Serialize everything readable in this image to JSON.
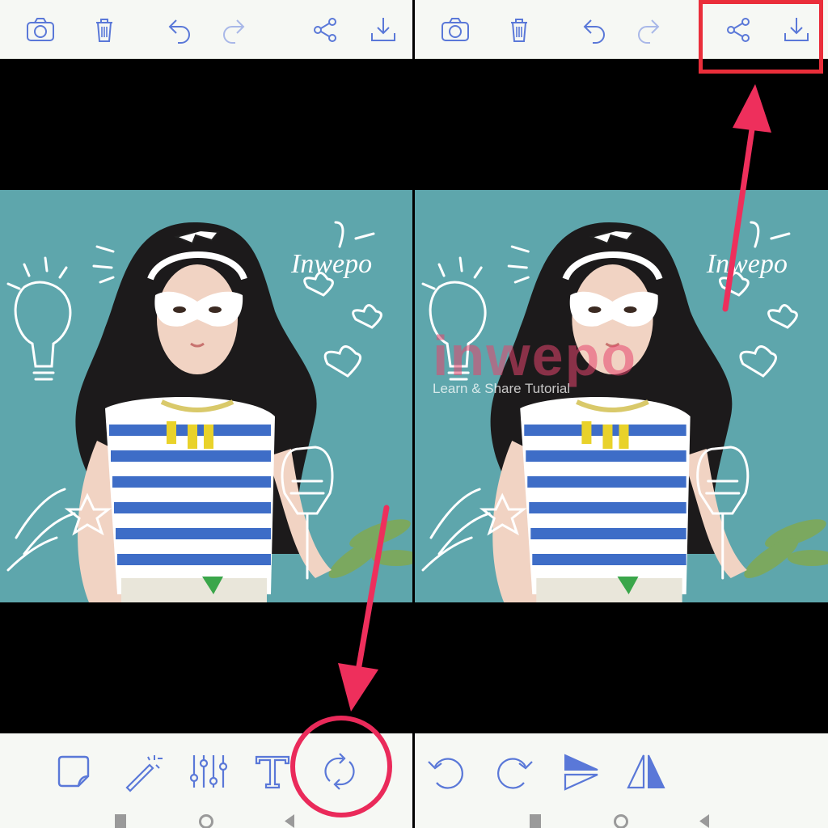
{
  "panels": [
    {
      "id": "left",
      "top_toolbar": [
        {
          "icon": "camera-icon",
          "label": "Camera"
        },
        {
          "icon": "trash-icon",
          "label": "Delete"
        },
        {
          "icon": "undo-icon",
          "label": "Undo"
        },
        {
          "icon": "redo-icon",
          "label": "Redo"
        },
        {
          "icon": "share-icon",
          "label": "Share"
        },
        {
          "icon": "download-icon",
          "label": "Save"
        }
      ],
      "photo_text": "Inwepo",
      "bottom_toolbar": [
        {
          "icon": "sticker-icon",
          "label": "Sticker"
        },
        {
          "icon": "magic-wand-icon",
          "label": "Effects"
        },
        {
          "icon": "sliders-icon",
          "label": "Adjust"
        },
        {
          "icon": "text-icon",
          "label": "Text"
        },
        {
          "icon": "rotate-icon",
          "label": "Rotate"
        }
      ]
    },
    {
      "id": "right",
      "top_toolbar": [
        {
          "icon": "camera-icon",
          "label": "Camera"
        },
        {
          "icon": "trash-icon",
          "label": "Delete"
        },
        {
          "icon": "undo-icon",
          "label": "Undo"
        },
        {
          "icon": "redo-icon",
          "label": "Redo"
        },
        {
          "icon": "share-icon",
          "label": "Share"
        },
        {
          "icon": "download-icon",
          "label": "Save"
        }
      ],
      "photo_text": "Inwepo",
      "bottom_toolbar": [
        {
          "icon": "rotate-left-icon",
          "label": "Rotate left"
        },
        {
          "icon": "rotate-right-icon",
          "label": "Rotate right"
        },
        {
          "icon": "flip-vertical-icon",
          "label": "Flip vertical"
        },
        {
          "icon": "flip-horizontal-icon",
          "label": "Flip horizontal"
        }
      ]
    }
  ],
  "watermark": {
    "brand": "inwepo",
    "tagline": "Learn & Share Tutorial"
  },
  "colors": {
    "icon": "#5a78d8",
    "icon_disabled": "#a9b8e8",
    "toolbar_bg": "#f6f8f4",
    "photo_bg": "#5ea6ac",
    "highlight": "#ea2e3a",
    "arrow": "#ee2f5c"
  }
}
